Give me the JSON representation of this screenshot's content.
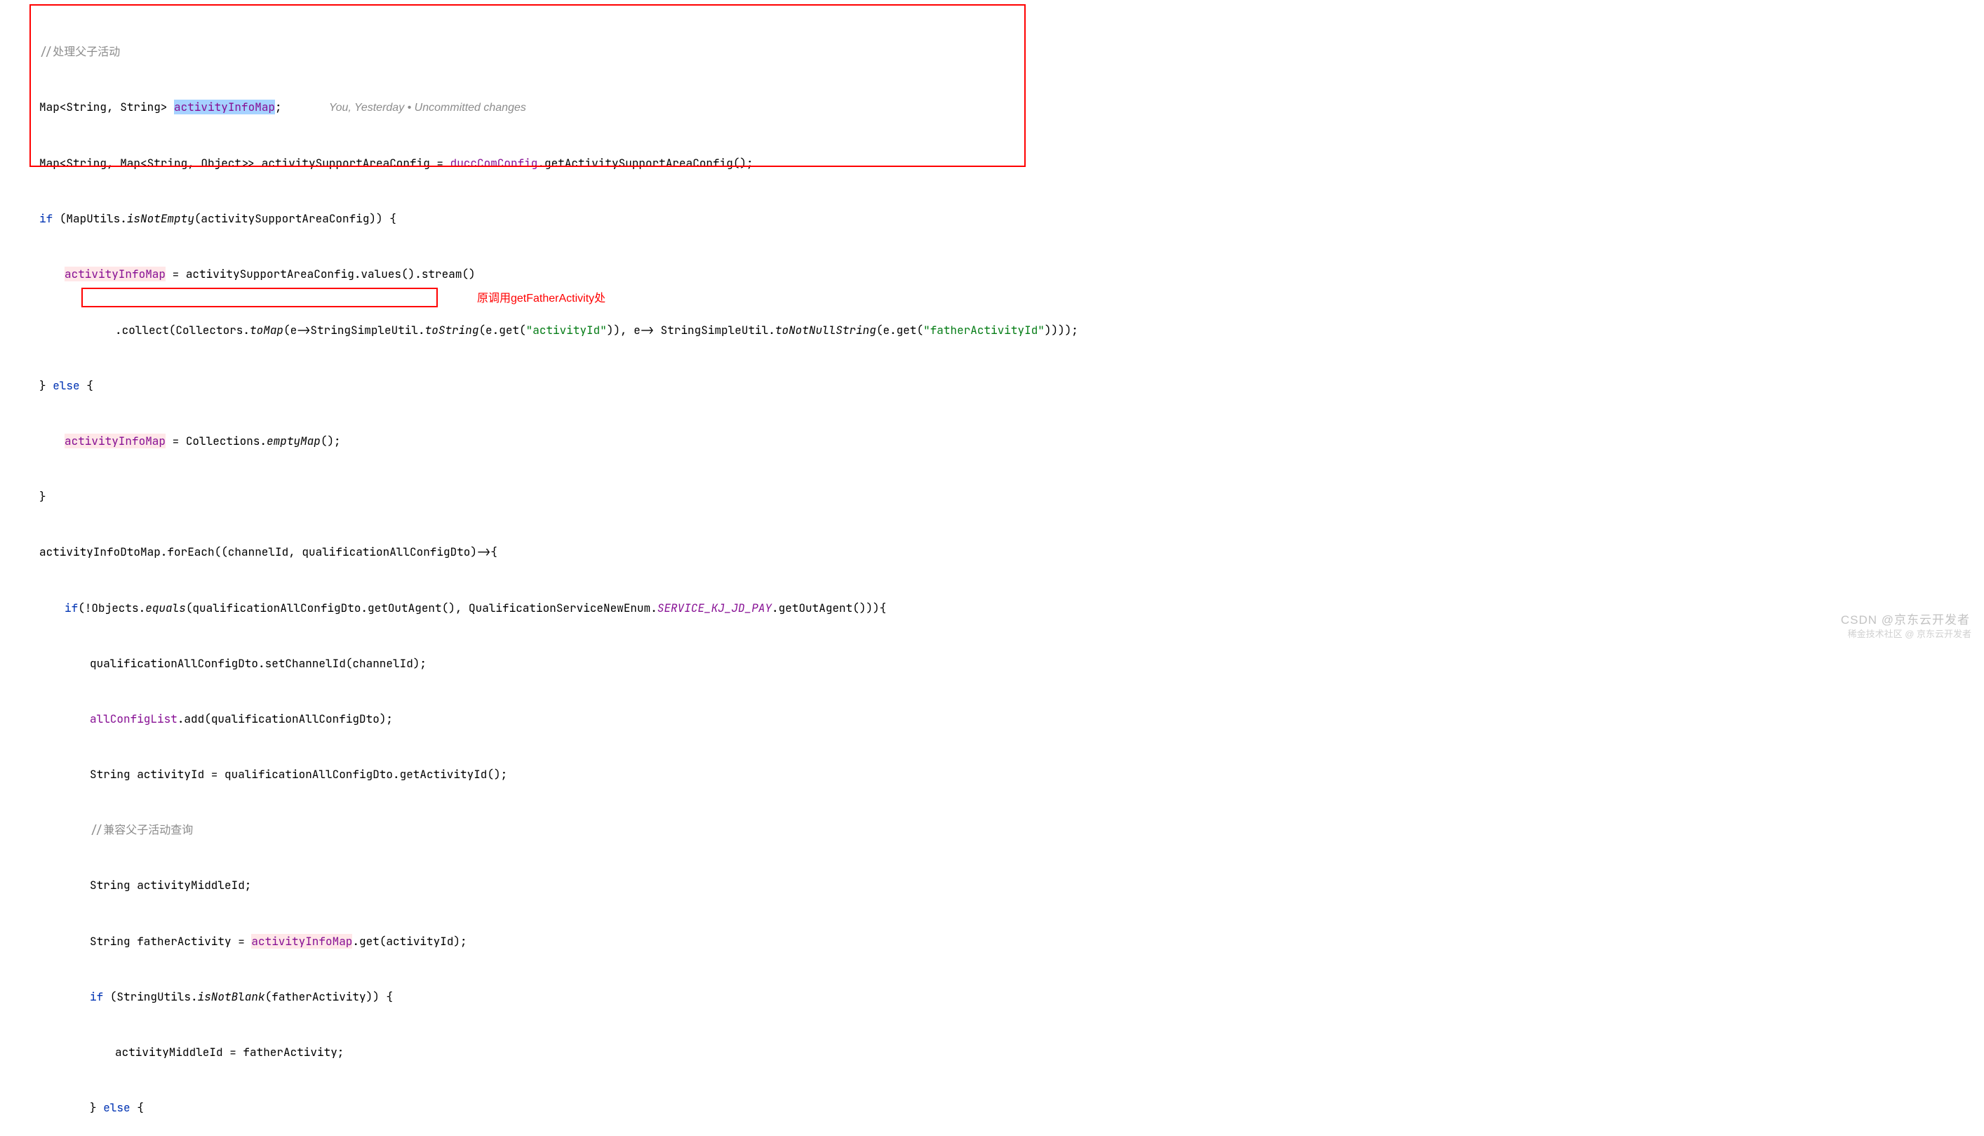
{
  "code": {
    "l1_comment": "//处理父子活动",
    "l2_a": "Map<String, String> ",
    "l2_var": "activityInfoMap",
    "l2_b": ";",
    "l2_hint": "You, Yesterday • Uncommitted changes",
    "l3_a": "Map<String, Map<String, Object>> activitySupportAreaConfig = ",
    "l3_f": "duccComConfig",
    "l3_b": ".getActivitySupportAreaConfig();",
    "l4_a": "if",
    "l4_b": " (MapUtils.",
    "l4_m": "isNotEmpty",
    "l4_c": "(activitySupportAreaConfig)) {",
    "l5_a": "activityInfoMap",
    "l5_b": " = activitySupportAreaConfig.values().stream()",
    "l6_a": ".collect(Collectors.",
    "l6_m": "toMap",
    "l6_b": "(e->StringSimpleUtil.",
    "l6_m2": "toString",
    "l6_c": "(e.get(",
    "l6_s1": "\"activityId\"",
    "l6_d": ")), e-> StringSimpleUtil.",
    "l6_m3": "toNotNullString",
    "l6_e": "(e.get(",
    "l6_s2": "\"fatherActivityId\"",
    "l6_f": "))));",
    "l7_a": "} ",
    "l7_kw": "else",
    "l7_b": " {",
    "l8_a": "activityInfoMap",
    "l8_b": " = Collections.",
    "l8_m": "emptyMap",
    "l8_c": "();",
    "l9": "}",
    "l10_a": "activityInfoDtoMap.forEach((channelId, qualificationAllConfigDto)->{",
    "l11_a": "if",
    "l11_b": "(!Objects.",
    "l11_m": "equals",
    "l11_c": "(qualificationAllConfigDto.getOutAgent(), QualificationServiceNewEnum.",
    "l11_f": "SERVICE_KJ_JD_PAY",
    "l11_d": ".getOutAgent())){",
    "l12": "qualificationAllConfigDto.setChannelId(channelId);",
    "l13_a": "allConfigList",
    "l13_b": ".add(qualificationAllConfigDto);",
    "l14": "String activityId = qualificationAllConfigDto.getActivityId();",
    "l15_comment": "//兼容父子活动查询",
    "l16": "String activityMiddleId;",
    "l17_a": "String fatherActivity = ",
    "l17_v": "activityInfoMap",
    "l17_b": ".get(activityId);",
    "l18_a": "if",
    "l18_b": " (StringUtils.",
    "l18_m": "isNotBlank",
    "l18_c": "(fatherActivity)) {",
    "l19": "activityMiddleId = fatherActivity;",
    "l20_a": "} ",
    "l20_kw": "else",
    "l20_b": " {"
  },
  "annotation": "原调用getFatherActivity处",
  "watermark": "CSDN @京东云开发者",
  "watermark2": "稀金技术社区 @ 京东云开发者"
}
